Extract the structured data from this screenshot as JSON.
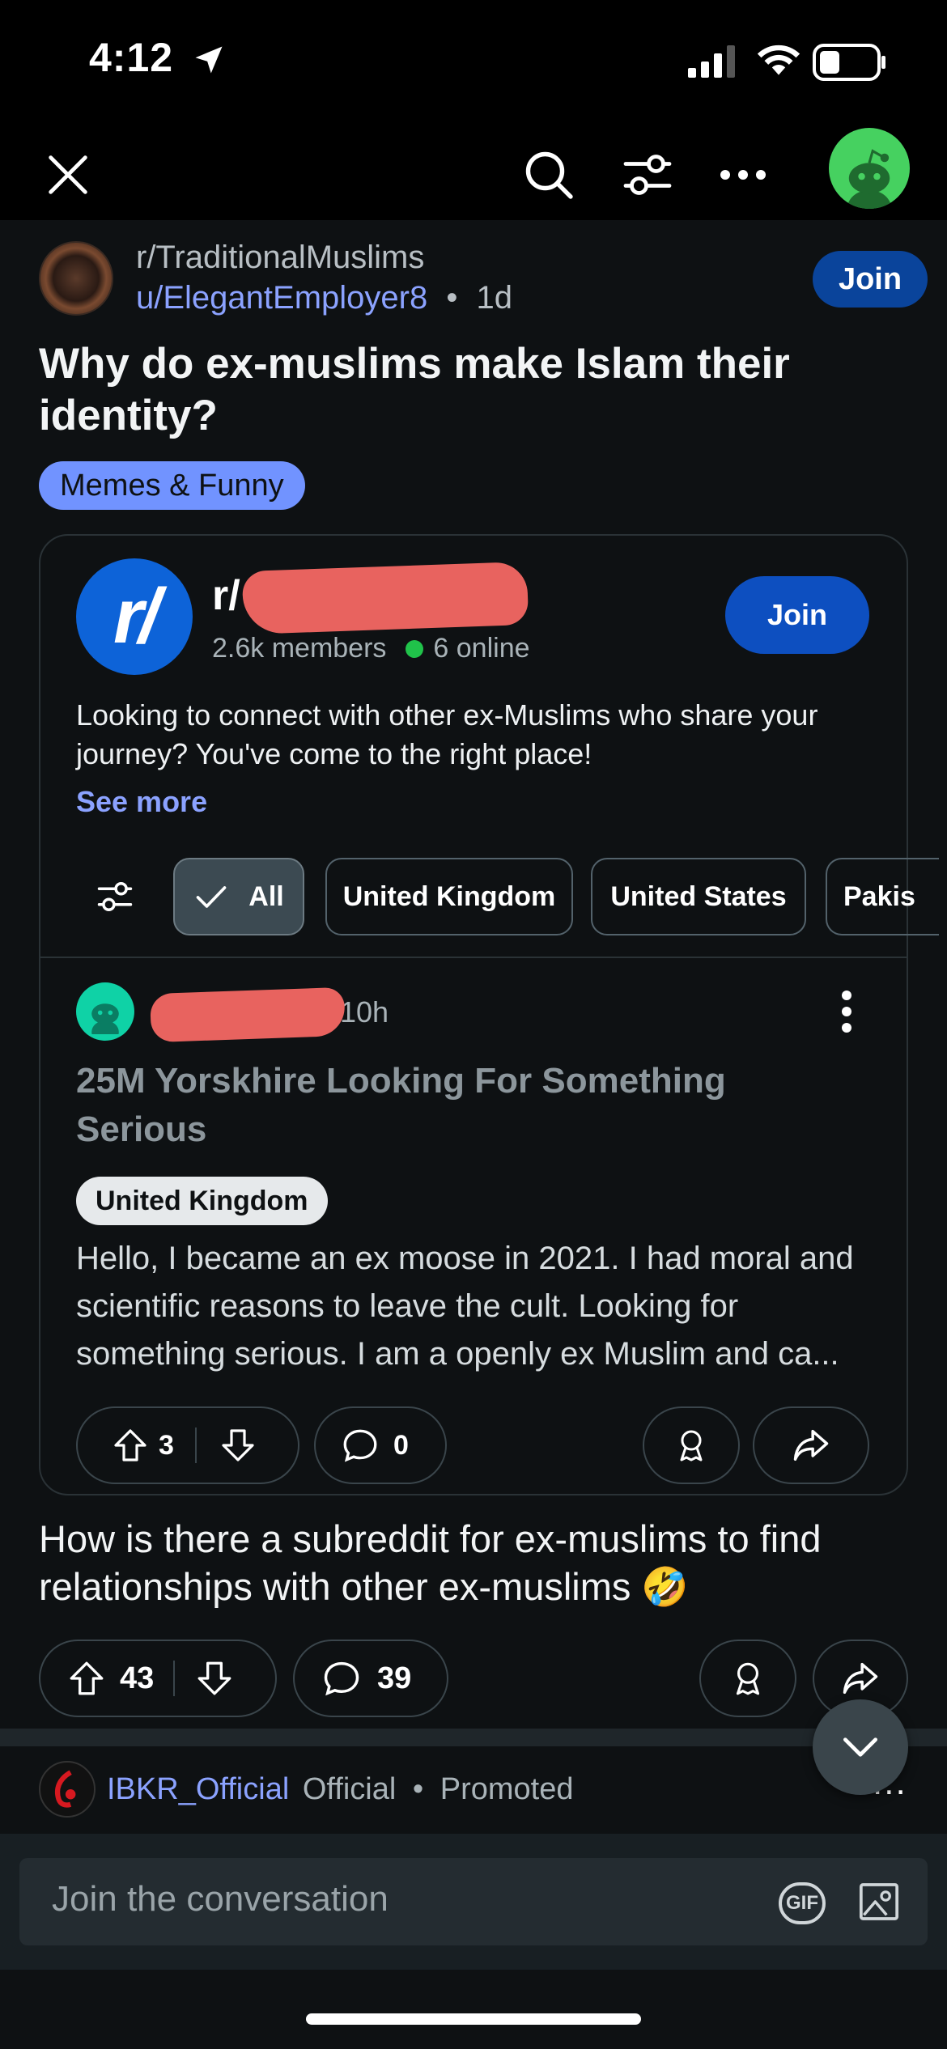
{
  "status_bar": {
    "time": "4:12"
  },
  "post": {
    "subreddit": "r/TraditionalMuslims",
    "author": "u/ElegantEmployer8",
    "separator": "•",
    "age": "1d",
    "join_label": "Join",
    "title": "Why do ex-muslims make Islam their identity?",
    "flair": "Memes & Funny",
    "body": "How is there a subreddit for ex-muslims to find relationships with other ex-muslims 🤣",
    "upvotes": "43",
    "comments": "39"
  },
  "embedded": {
    "logo_text": "r/",
    "name_visible": "r/",
    "members": "2.6k members",
    "online": "6 online",
    "join_label": "Join",
    "description": "Looking to connect with other ex-Muslims who share your journey? You've come to the right place!",
    "see_more": "See more",
    "filters": [
      {
        "label": "All",
        "active": true
      },
      {
        "label": "United Kingdom",
        "active": false
      },
      {
        "label": "United States",
        "active": false
      },
      {
        "label": "Pakis",
        "active": false
      }
    ],
    "inner_post": {
      "age_fragment": "10h",
      "title": "25M Yorskhire Looking For Something Serious",
      "flair": "United Kingdom",
      "body": "Hello, I became an ex moose in 2021. I had moral and scientific reasons to leave the cult. Looking for something serious. I am a openly ex Muslim and ca...",
      "upvotes": "3",
      "comments": "0"
    }
  },
  "promoted": {
    "advertiser": "IBKR_Official",
    "official": "Official",
    "separator": "•",
    "promoted": "Promoted",
    "more": "..."
  },
  "composer": {
    "placeholder": "Join the conversation",
    "gif_label": "GIF"
  },
  "colors": {
    "background": "#0e1113",
    "link_blue": "#8ba2ff",
    "join_blue": "#0a449b",
    "flair_blue": "#7193ff",
    "online_green": "#20c34a",
    "redaction": "#e8635f"
  }
}
